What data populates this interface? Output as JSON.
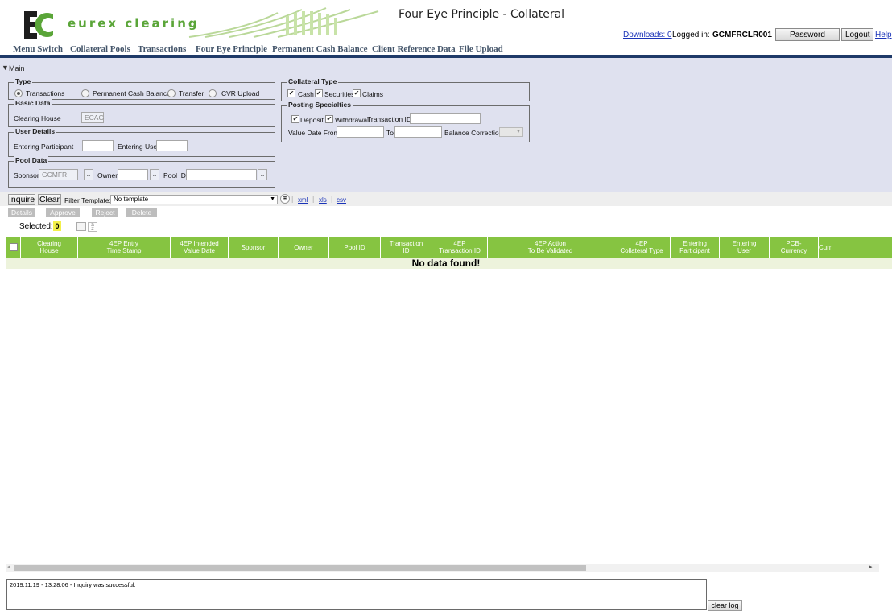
{
  "header": {
    "logo_text": "eurex clearing",
    "title": "Four Eye Principle - Collateral",
    "downloads": "Downloads: 0",
    "logged_label": "Logged in:",
    "logged_user": "GCMFRCLR001",
    "password_reset": "Password Reset",
    "logout": "Logout",
    "help": "Help"
  },
  "menu": [
    "Menu Switch",
    "Collateral Pools",
    "Transactions",
    "Four Eye Principle",
    "Permanent Cash Balance",
    "Client Reference Data",
    "File Upload"
  ],
  "main": {
    "label": "Main",
    "type": {
      "legend": "Type",
      "options": [
        "Transactions",
        "Permanent Cash Balance",
        "Transfer",
        "CVR Upload"
      ],
      "selected": "Transactions"
    },
    "basic_data": {
      "legend": "Basic Data",
      "clearing_house_label": "Clearing House",
      "clearing_house_value": "ECAG"
    },
    "user_details": {
      "legend": "User Details",
      "entering_participant_label": "Entering Participant",
      "entering_user_label": "Entering User"
    },
    "pool_data": {
      "legend": "Pool Data",
      "sponsor_label": "Sponsor",
      "sponsor_value": "GCMFR",
      "owner_label": "Owner",
      "pool_id_label": "Pool ID",
      "dots": ".."
    },
    "collateral_type": {
      "legend": "Collateral Type",
      "options": [
        "Cash",
        "Securities",
        "Claims"
      ],
      "check": "✔"
    },
    "posting": {
      "legend": "Posting Specialties",
      "deposit": "Deposit",
      "withdrawal": "Withdrawal",
      "transaction_id_label": "Transaction ID",
      "value_date_from_label": "Value Date From",
      "to_label": "To",
      "balance_correction_label": "Balance Correction",
      "select_arrow": "▼"
    }
  },
  "toolbar": {
    "inquire": "Inquire",
    "clear": "Clear",
    "filter_label": "Filter Template:",
    "filter_value": "No template",
    "exports": [
      "xml",
      "xls",
      "csv"
    ],
    "actions": [
      "Details",
      "Approve",
      "Reject",
      "Delete"
    ],
    "selected_label": "Selected:",
    "selected_count": "0"
  },
  "table": {
    "columns": [
      "Clearing\nHouse",
      "4EP Entry\nTime Stamp",
      "4EP Intended\nValue Date",
      "Sponsor",
      "Owner",
      "Pool ID",
      "Transaction\nID",
      "4EP\nTransaction ID",
      "4EP Action\nTo Be Validated",
      "4EP\nCollateral Type",
      "Entering\nParticipant",
      "Entering\nUser",
      "PCB-\nCurrency",
      "Curr"
    ],
    "empty_message": "No data found!"
  },
  "log": {
    "entry": "2019.11.19 - 13:28:06 - Inquiry was successful.",
    "clear_log": "clear log"
  },
  "colors": {
    "brand_green": "#5aa538",
    "header_green": "#86c441",
    "nav_blue": "#1f3a68",
    "panel": "#dfe1ef"
  },
  "icons": [
    "eurex-logo",
    "collapse-triangle-icon",
    "filter-add-icon",
    "column-settings-icon",
    "sort-icon",
    "scroll-left-icon",
    "scroll-right-icon"
  ]
}
